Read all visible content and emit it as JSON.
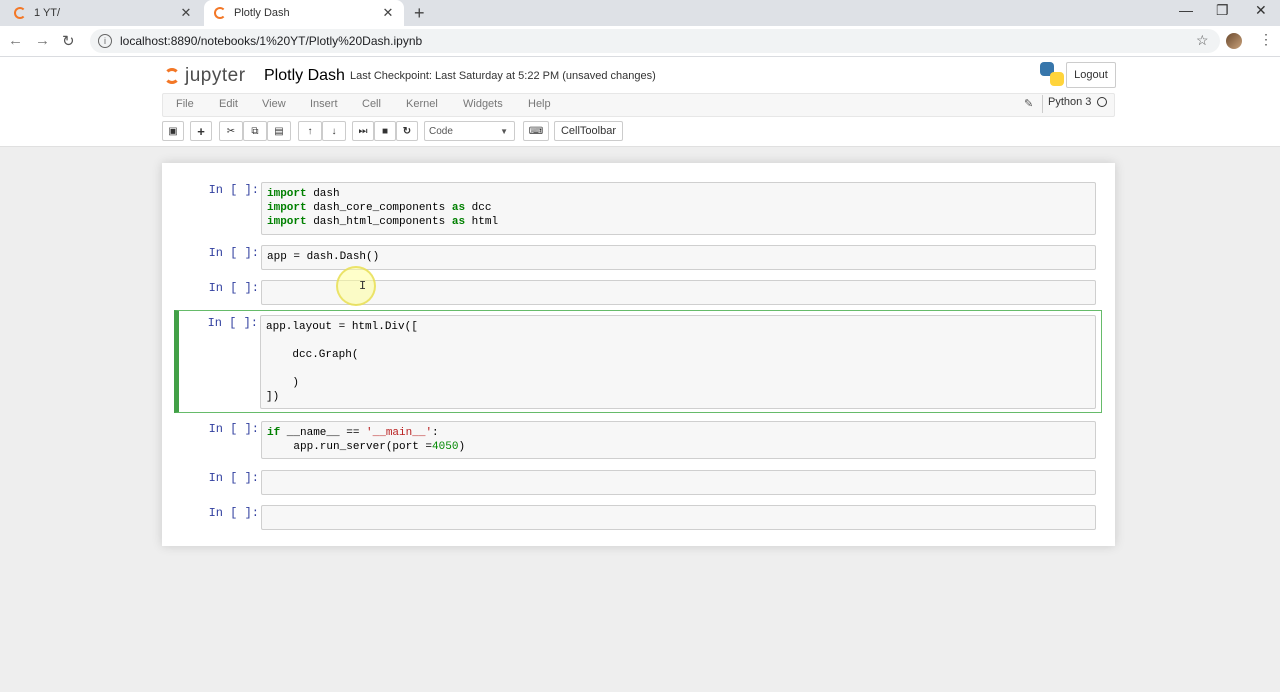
{
  "browser": {
    "tabs": [
      {
        "label": "1 YT/",
        "active": false
      },
      {
        "label": "Plotly Dash",
        "active": true
      }
    ],
    "url": "localhost:8890/notebooks/1%20YT/Plotly%20Dash.ipynb"
  },
  "jupyter": {
    "logo_text": "jupyter",
    "notebook_name": "Plotly Dash",
    "checkpoint_label": "Last Checkpoint:",
    "checkpoint_value": "Last Saturday at 5:22 PM",
    "unsaved": "(unsaved changes)",
    "logout_label": "Logout",
    "menu": [
      "File",
      "Edit",
      "View",
      "Insert",
      "Cell",
      "Kernel",
      "Widgets",
      "Help"
    ],
    "kernel_name": "Python 3",
    "cell_type": "Code",
    "celltoolbar_label": "CellToolbar"
  },
  "cells": [
    {
      "prompt": "In [ ]:"
    },
    {
      "prompt": "In [ ]:"
    },
    {
      "prompt": "In [ ]:"
    },
    {
      "prompt": "In [ ]:"
    },
    {
      "prompt": "In [ ]:"
    },
    {
      "prompt": "In [ ]:"
    },
    {
      "prompt": "In [ ]:"
    }
  ],
  "code": {
    "c1_l1_kw": "import",
    "c1_l1_rest": " dash",
    "c1_l2_kw": "import",
    "c1_l2_mid": " dash_core_components ",
    "c1_l2_as": "as",
    "c1_l2_end": " dcc",
    "c1_l3_kw": "import",
    "c1_l3_mid": " dash_html_components ",
    "c1_l3_as": "as",
    "c1_l3_end": " html",
    "c2": "app = dash.Dash()",
    "c4_l1": "app.layout = html.Div([",
    "c4_l2": "    dcc.Graph(",
    "c4_l3": "    )",
    "c4_l4": "])",
    "c5_if": "if",
    "c5_mid": " __name__ == ",
    "c5_str": "'__main__'",
    "c5_end": ":",
    "c5_l2a": "    app.run_server(port =",
    "c5_num": "4050",
    "c5_l2b": ")"
  }
}
